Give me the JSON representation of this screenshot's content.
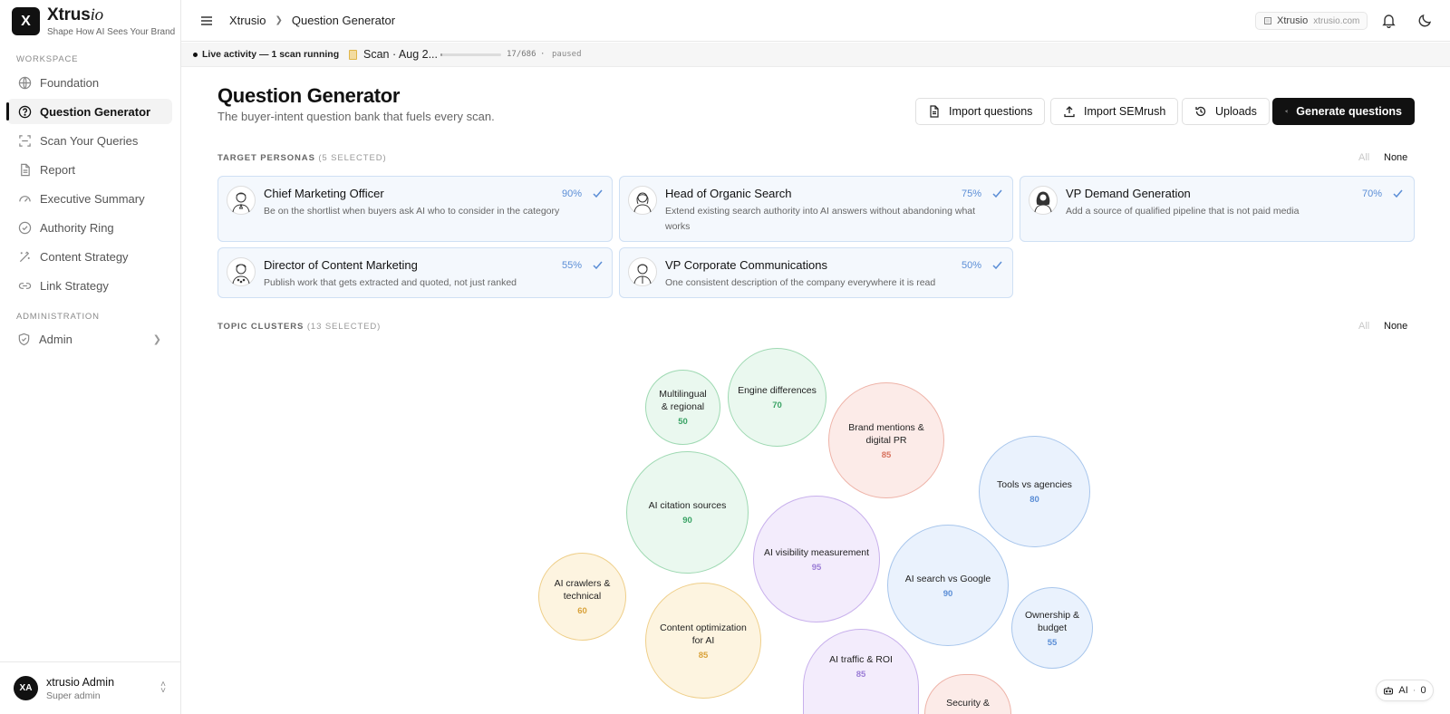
{
  "brand": {
    "logo_letter": "X",
    "name_main": "Xtrus",
    "name_italic": "io",
    "tagline": "Shape How AI Sees Your Brand"
  },
  "sidebar": {
    "section_workspace": "WORKSPACE",
    "items": [
      {
        "label": "Foundation",
        "icon": "globe-icon"
      },
      {
        "label": "Question Generator",
        "icon": "question-circle-icon",
        "active": true
      },
      {
        "label": "Scan Your Queries",
        "icon": "scan-icon"
      },
      {
        "label": "Report",
        "icon": "document-icon"
      },
      {
        "label": "Executive Summary",
        "icon": "gauge-icon"
      },
      {
        "label": "Authority Ring",
        "icon": "check-circle-icon"
      },
      {
        "label": "Content Strategy",
        "icon": "wand-icon"
      },
      {
        "label": "Link Strategy",
        "icon": "link-icon"
      }
    ],
    "section_admin": "ADMINISTRATION",
    "admin_label": "Admin"
  },
  "user": {
    "initials": "XA",
    "name": "xtrusio Admin",
    "role": "Super admin"
  },
  "topbar": {
    "breadcrumb": [
      "Xtrusio",
      "Question Generator"
    ],
    "workspace_name": "Xtrusio",
    "workspace_domain": "xtrusio.com"
  },
  "activity": {
    "text": "Live activity — 1 scan running",
    "scan_label": "Scan · Aug 2...",
    "progress": 0.025,
    "count": "17/686",
    "separator": "·",
    "state": "paused"
  },
  "page": {
    "title": "Question Generator",
    "subtitle": "The buyer-intent question bank that fuels every scan."
  },
  "actions": {
    "import_questions": "Import questions",
    "import_semrush": "Import SEMrush",
    "uploads": "Uploads",
    "generate": "Generate questions"
  },
  "personas_section": {
    "label": "TARGET PERSONAS",
    "count": "(5 SELECTED)",
    "all": "All",
    "none": "None",
    "items": [
      {
        "name": "Chief Marketing Officer",
        "pct": "90%",
        "desc": "Be on the shortlist when buyers ask AI who to consider in the category"
      },
      {
        "name": "Head of Organic Search",
        "pct": "75%",
        "desc": "Extend existing search authority into AI answers without abandoning what works"
      },
      {
        "name": "VP Demand Generation",
        "pct": "70%",
        "desc": "Add a source of qualified pipeline that is not paid media"
      },
      {
        "name": "Director of Content Marketing",
        "pct": "55%",
        "desc": "Publish work that gets extracted and quoted, not just ranked"
      },
      {
        "name": "VP Corporate Communications",
        "pct": "50%",
        "desc": "One consistent description of the company everywhere it is read"
      }
    ]
  },
  "topics_section": {
    "label": "TOPIC CLUSTERS",
    "count": "(13 SELECTED)",
    "all": "All",
    "none": "None",
    "bubbles": [
      {
        "label": "Multilingual & regional",
        "value": "50",
        "color": "green"
      },
      {
        "label": "Engine differences",
        "value": "70",
        "color": "green"
      },
      {
        "label": "Brand mentions & digital PR",
        "value": "85",
        "color": "red"
      },
      {
        "label": "Tools vs agencies",
        "value": "80",
        "color": "blue"
      },
      {
        "label": "AI citation sources",
        "value": "90",
        "color": "green"
      },
      {
        "label": "AI visibility measurement",
        "value": "95",
        "color": "purple"
      },
      {
        "label": "AI search vs Google",
        "value": "90",
        "color": "blue"
      },
      {
        "label": "AI crawlers & technical",
        "value": "60",
        "color": "yellow"
      },
      {
        "label": "Content optimization for AI",
        "value": "85",
        "color": "yellow"
      },
      {
        "label": "Ownership & budget",
        "value": "55",
        "color": "blue"
      },
      {
        "label": "AI traffic & ROI",
        "value": "85",
        "color": "purple"
      },
      {
        "label": "Security &",
        "value": "",
        "color": "red"
      }
    ]
  },
  "ai_chip": {
    "label": "AI",
    "separator": "·",
    "count": "0"
  }
}
